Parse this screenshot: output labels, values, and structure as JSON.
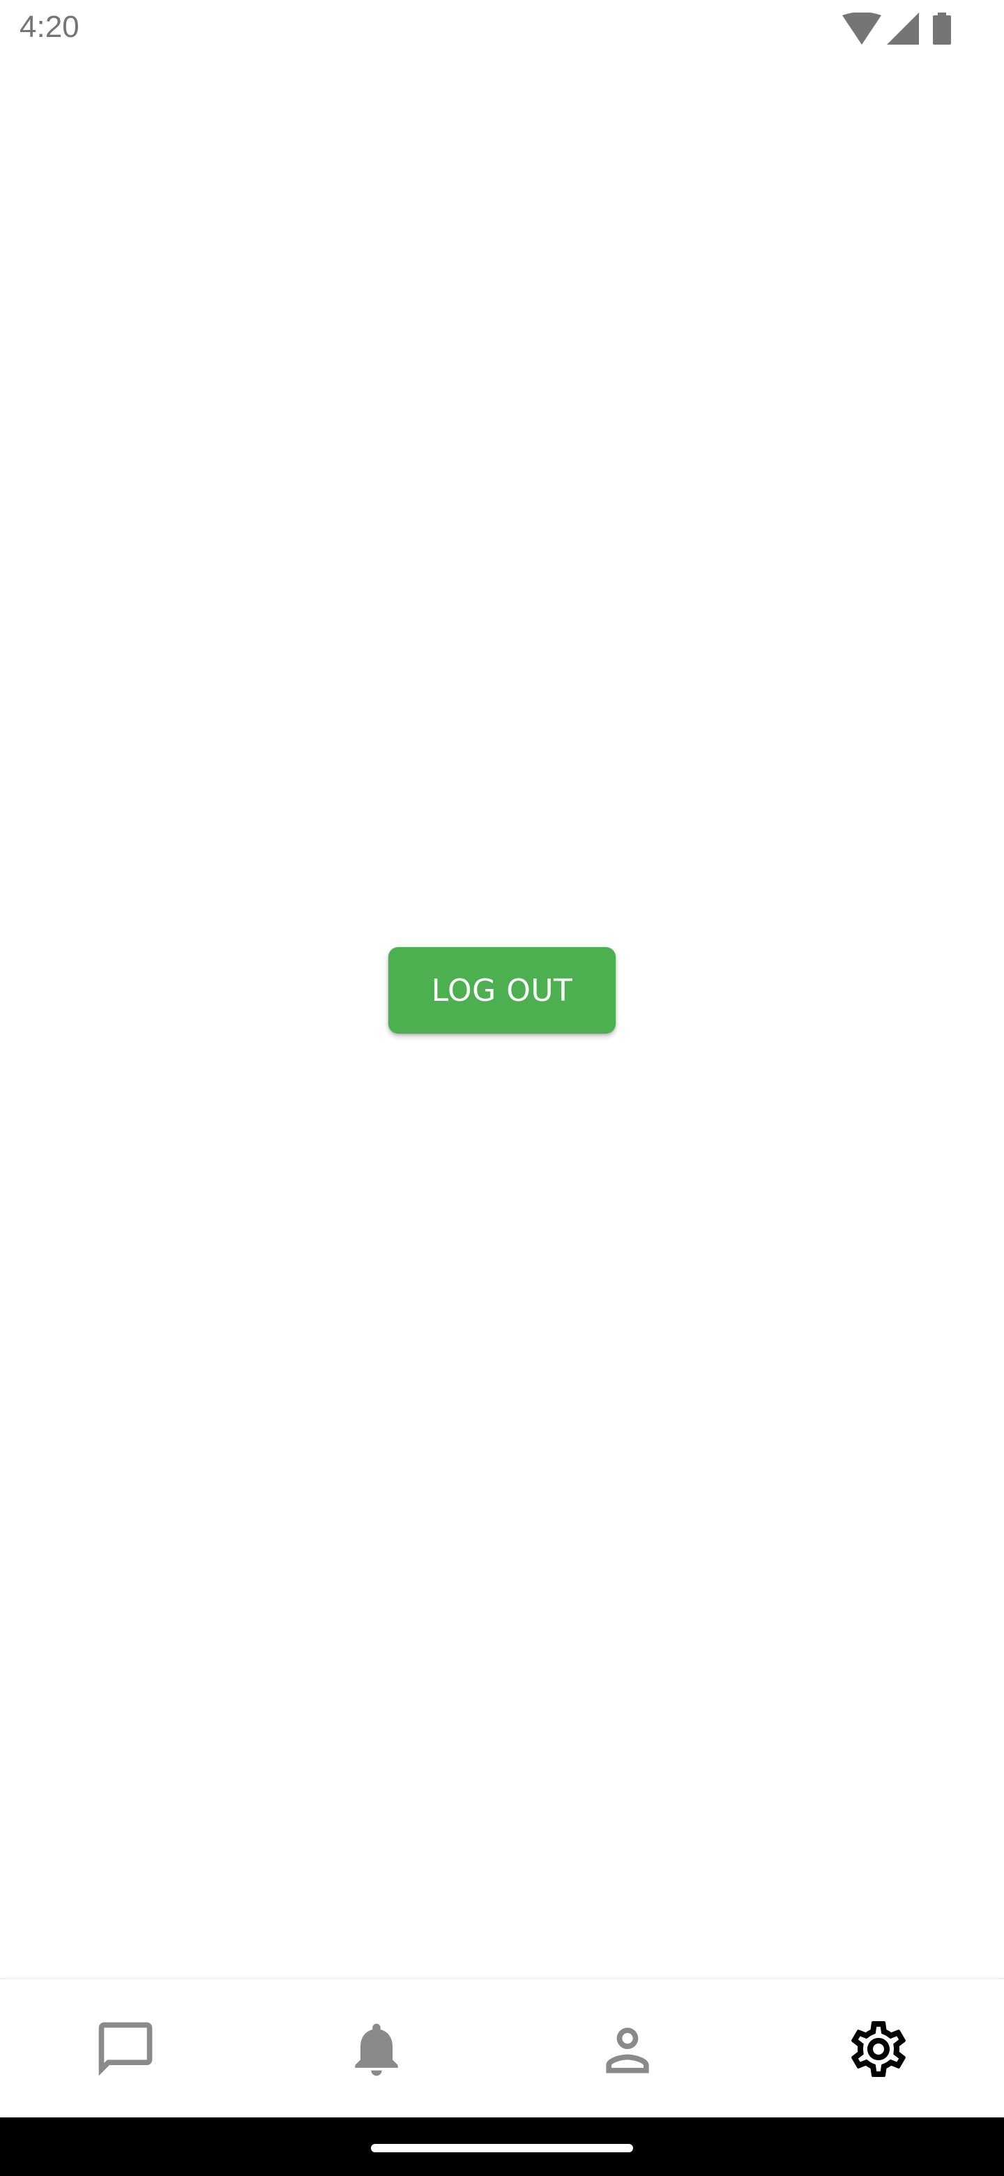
{
  "status_bar": {
    "time": "4:20",
    "icons": [
      "wifi-icon",
      "cellular-signal-icon",
      "battery-icon"
    ],
    "icon_color": "#757575"
  },
  "main": {
    "logout_label": "LOG OUT",
    "button_color": "#4caf50",
    "button_text_color": "#ffffff"
  },
  "bottom_nav": {
    "items": [
      {
        "icon": "chat-bubble-icon",
        "selected": false
      },
      {
        "icon": "bell-icon",
        "selected": false
      },
      {
        "icon": "person-icon",
        "selected": false
      },
      {
        "icon": "gear-icon",
        "selected": true
      }
    ],
    "inactive_color": "#8a8a8a",
    "active_color": "#000000"
  }
}
